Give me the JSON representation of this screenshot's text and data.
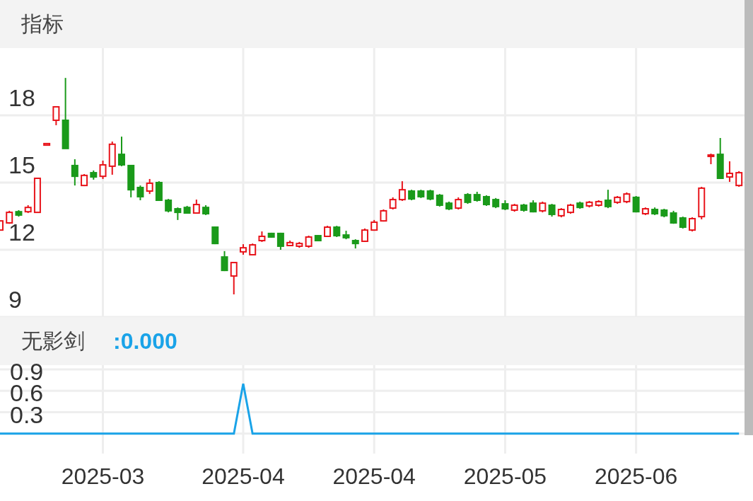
{
  "header": {
    "title": "指标"
  },
  "price_chart": {
    "chart_data": {
      "type": "candlestick",
      "ylim": [
        9,
        21
      ],
      "yticks": [
        9,
        12,
        15,
        18
      ],
      "grid": true,
      "categories": [
        null,
        null,
        null,
        null,
        null,
        null,
        null,
        null,
        null,
        null,
        null,
        null,
        null,
        null,
        null,
        null,
        null,
        null,
        null,
        null,
        null,
        null,
        null,
        null,
        null,
        null,
        null,
        null,
        null,
        null,
        null,
        null,
        null,
        null,
        null,
        null,
        null,
        null,
        null,
        null,
        null,
        null,
        null,
        null,
        null,
        null,
        null,
        null,
        null,
        null,
        null,
        null,
        null,
        null,
        null,
        null,
        null,
        null,
        null,
        null,
        null,
        null,
        null,
        null,
        null,
        null,
        null,
        null,
        null,
        null,
        null,
        null,
        null,
        null,
        null,
        null,
        null,
        null,
        null,
        null
      ],
      "ohlc": [
        [
          12.88,
          13.29,
          12.88,
          13.29
        ],
        [
          13.2,
          13.74,
          13.16,
          13.67
        ],
        [
          13.7,
          13.77,
          13.48,
          13.55
        ],
        [
          13.7,
          13.99,
          13.64,
          13.89
        ],
        [
          13.67,
          15.19,
          13.67,
          15.19
        ],
        [
          16.67,
          16.74,
          16.67,
          16.74
        ],
        [
          17.78,
          18.38,
          17.56,
          18.38
        ],
        [
          17.78,
          19.67,
          16.52,
          16.52
        ],
        [
          15.76,
          16.04,
          14.87,
          15.28
        ],
        [
          14.87,
          15.38,
          14.84,
          15.32
        ],
        [
          15.44,
          15.54,
          15.13,
          15.25
        ],
        [
          15.28,
          15.98,
          15.16,
          15.79
        ],
        [
          15.73,
          16.83,
          15.35,
          16.71
        ],
        [
          16.26,
          17.05,
          15.73,
          15.79
        ],
        [
          15.76,
          15.76,
          14.34,
          14.68
        ],
        [
          14.78,
          14.87,
          14.21,
          14.37
        ],
        [
          14.62,
          15.16,
          14.49,
          14.97
        ],
        [
          15.0,
          15.06,
          14.18,
          14.21
        ],
        [
          14.21,
          14.27,
          13.67,
          13.74
        ],
        [
          13.83,
          13.89,
          13.33,
          13.67
        ],
        [
          13.89,
          13.96,
          13.61,
          13.64
        ],
        [
          13.64,
          14.24,
          13.61,
          14.02
        ],
        [
          13.89,
          13.99,
          13.55,
          13.61
        ],
        [
          13.01,
          13.04,
          12.25,
          12.28
        ],
        [
          11.68,
          11.94,
          11.05,
          11.08
        ],
        [
          10.83,
          11.43,
          10.01,
          11.43
        ],
        [
          11.91,
          12.25,
          11.78,
          12.09
        ],
        [
          11.78,
          12.28,
          11.75,
          12.22
        ],
        [
          12.41,
          12.82,
          12.35,
          12.6
        ],
        [
          12.73,
          12.76,
          12.54,
          12.57
        ],
        [
          12.73,
          12.76,
          12.0,
          12.16
        ],
        [
          12.19,
          12.41,
          12.16,
          12.32
        ],
        [
          12.16,
          12.35,
          12.09,
          12.28
        ],
        [
          12.16,
          12.63,
          12.09,
          12.57
        ],
        [
          12.63,
          12.66,
          12.38,
          12.41
        ],
        [
          12.6,
          13.07,
          12.57,
          13.01
        ],
        [
          13.01,
          13.07,
          12.57,
          12.63
        ],
        [
          12.66,
          12.85,
          12.47,
          12.54
        ],
        [
          12.41,
          12.47,
          12.06,
          12.28
        ],
        [
          12.38,
          12.95,
          12.35,
          12.88
        ],
        [
          12.88,
          13.33,
          12.85,
          13.23
        ],
        [
          13.29,
          13.8,
          13.26,
          13.74
        ],
        [
          13.86,
          14.34,
          13.8,
          14.24
        ],
        [
          14.24,
          15.06,
          14.18,
          14.68
        ],
        [
          14.62,
          14.68,
          14.21,
          14.27
        ],
        [
          14.62,
          14.68,
          14.31,
          14.37
        ],
        [
          14.62,
          14.68,
          14.21,
          14.27
        ],
        [
          14.43,
          14.49,
          13.93,
          13.99
        ],
        [
          14.08,
          14.15,
          13.77,
          13.83
        ],
        [
          13.86,
          14.34,
          13.8,
          14.24
        ],
        [
          14.46,
          14.53,
          14.05,
          14.12
        ],
        [
          14.46,
          14.59,
          14.15,
          14.21
        ],
        [
          14.37,
          14.43,
          13.96,
          14.02
        ],
        [
          14.24,
          14.31,
          13.86,
          13.93
        ],
        [
          14.05,
          14.21,
          13.77,
          13.83
        ],
        [
          13.77,
          14.05,
          13.7,
          13.99
        ],
        [
          13.99,
          14.05,
          13.7,
          13.77
        ],
        [
          14.08,
          14.21,
          13.67,
          13.7
        ],
        [
          13.74,
          14.15,
          13.67,
          14.08
        ],
        [
          13.99,
          14.05,
          13.48,
          13.58
        ],
        [
          13.52,
          13.86,
          13.45,
          13.8
        ],
        [
          13.67,
          14.05,
          13.61,
          13.99
        ],
        [
          14.08,
          14.15,
          13.83,
          13.89
        ],
        [
          13.96,
          14.18,
          13.89,
          14.12
        ],
        [
          13.99,
          14.21,
          13.93,
          14.15
        ],
        [
          14.21,
          14.68,
          13.86,
          13.93
        ],
        [
          14.12,
          14.4,
          14.05,
          14.34
        ],
        [
          14.15,
          14.56,
          14.08,
          14.49
        ],
        [
          14.34,
          14.4,
          13.67,
          13.7
        ],
        [
          13.61,
          13.89,
          13.55,
          13.83
        ],
        [
          13.8,
          13.89,
          13.55,
          13.61
        ],
        [
          13.77,
          13.83,
          13.45,
          13.52
        ],
        [
          13.64,
          13.74,
          13.16,
          13.2
        ],
        [
          13.42,
          13.48,
          12.95,
          13.01
        ],
        [
          12.88,
          13.45,
          12.82,
          13.39
        ],
        [
          13.48,
          14.81,
          13.36,
          14.75
        ],
        [
          16.17,
          16.29,
          15.82,
          16.23
        ],
        [
          16.26,
          16.99,
          15.16,
          15.19
        ],
        [
          15.25,
          15.95,
          15.03,
          15.41
        ],
        [
          14.87,
          15.51,
          14.81,
          15.44
        ]
      ]
    }
  },
  "indicator": {
    "name": "无影剑",
    "value": ":0.000"
  },
  "indicator_chart": {
    "chart_data": {
      "type": "line",
      "ylim": [
        -0.28,
        0.96
      ],
      "yticks": [
        0.3,
        0.6,
        0.9
      ],
      "grid": true,
      "categories": [
        null,
        null,
        null,
        null,
        null,
        null,
        null,
        null,
        null,
        null,
        null,
        "2025-03",
        null,
        null,
        null,
        null,
        null,
        null,
        null,
        null,
        null,
        null,
        null,
        null,
        null,
        null,
        "2025-04",
        null,
        null,
        null,
        null,
        null,
        null,
        null,
        null,
        null,
        null,
        null,
        null,
        null,
        "2025-04",
        null,
        null,
        null,
        null,
        null,
        null,
        null,
        null,
        null,
        null,
        null,
        null,
        null,
        "2025-05",
        null,
        null,
        null,
        null,
        null,
        null,
        null,
        null,
        null,
        null,
        null,
        null,
        null,
        "2025-06",
        null,
        null,
        null,
        null,
        null,
        null,
        null,
        null,
        null,
        null,
        null
      ],
      "series": [
        {
          "color": "#1aa3e8",
          "values": [
            0,
            0,
            0,
            0,
            0,
            0,
            0,
            0,
            0,
            0,
            0,
            0,
            0,
            0,
            0,
            0,
            0,
            0,
            0,
            0,
            0,
            0,
            0,
            0,
            0,
            0,
            0.7,
            0,
            0,
            0,
            0,
            0,
            0,
            0,
            0,
            0,
            0,
            0,
            0,
            0,
            0,
            0,
            0,
            0,
            0,
            0,
            0,
            0,
            0,
            0,
            0,
            0,
            0,
            0,
            0,
            0,
            0,
            0,
            0,
            0,
            0,
            0,
            0,
            0,
            0,
            0,
            0,
            0,
            0,
            0,
            0,
            0,
            0,
            0,
            0,
            0,
            0,
            0,
            0,
            0
          ]
        }
      ]
    }
  }
}
